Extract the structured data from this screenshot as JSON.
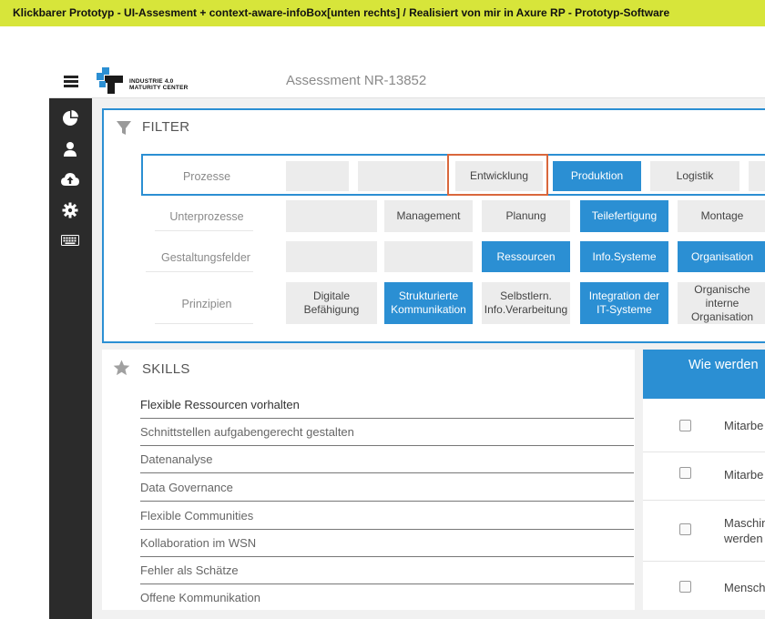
{
  "caption": "Klickbarer Prototyp - UI-Assesment + context-aware-infoBox[unten rechts] / Realisiert von mir in Axure RP - Prototyp-Software",
  "header": {
    "logo_line1": "INDUSTRIE 4.0",
    "logo_line2": "MATURITY CENTER",
    "title": "Assessment NR-13852"
  },
  "colors": {
    "accent": "#2b8fd3",
    "highlight": "#d9673c",
    "banner": "#d7e53a",
    "sidebar": "#2b2b2b"
  },
  "sidebar": {
    "icons": [
      "pie-chart-icon",
      "user-icon",
      "cloud-upload-icon",
      "gear-icon",
      "keyboard-icon"
    ]
  },
  "filter": {
    "title": "FILTER",
    "rows": [
      {
        "label": "Prozesse",
        "chips": [
          {
            "text": "",
            "state": "empty"
          },
          {
            "text": "",
            "state": "empty"
          },
          {
            "text": "Entwicklung",
            "state": "grey"
          },
          {
            "text": "Produktion",
            "state": "blue"
          },
          {
            "text": "Logistik",
            "state": "grey"
          },
          {
            "text": "",
            "state": "empty"
          }
        ]
      },
      {
        "label": "Unterprozesse",
        "chips": [
          {
            "text": "",
            "state": "empty"
          },
          {
            "text": "Management",
            "state": "grey"
          },
          {
            "text": "Planung",
            "state": "grey"
          },
          {
            "text": "Teilefertigung",
            "state": "blue"
          },
          {
            "text": "Montage",
            "state": "grey"
          }
        ]
      },
      {
        "label": "Gestaltungsfelder",
        "chips": [
          {
            "text": "",
            "state": "empty"
          },
          {
            "text": "",
            "state": "empty"
          },
          {
            "text": "Ressourcen",
            "state": "blue"
          },
          {
            "text": "Info.Systeme",
            "state": "blue"
          },
          {
            "text": "Organisation",
            "state": "blue"
          }
        ]
      },
      {
        "label": "Prinzipien",
        "chips": [
          {
            "text": "Digitale\nBefähigung",
            "state": "grey"
          },
          {
            "text": "Strukturierte\nKommunikation",
            "state": "blue"
          },
          {
            "text": "Selbstlern.\nInfo.Verarbeitung",
            "state": "grey"
          },
          {
            "text": "Integration der\nIT-Systeme",
            "state": "blue"
          },
          {
            "text": "Organische\ninterne\nOrganisation",
            "state": "grey"
          }
        ]
      }
    ]
  },
  "skills": {
    "title": "SKILLS",
    "items": [
      "Flexible Ressourcen vorhalten",
      "Schnittstellen aufgabengerecht gestalten",
      "Datenanalyse",
      "Data Governance",
      "Flexible Communities",
      "Kollaboration im WSN",
      "Fehler als Schätze",
      "Offene Kommunikation"
    ]
  },
  "info": {
    "title": "Wie werden",
    "items": [
      {
        "text": "Mitarbe",
        "checked": false
      },
      {
        "text": "Mitarbe",
        "checked": false
      },
      {
        "text": "Maschin\nwerden",
        "checked": false
      },
      {
        "text": "Mensch",
        "checked": false
      }
    ]
  }
}
